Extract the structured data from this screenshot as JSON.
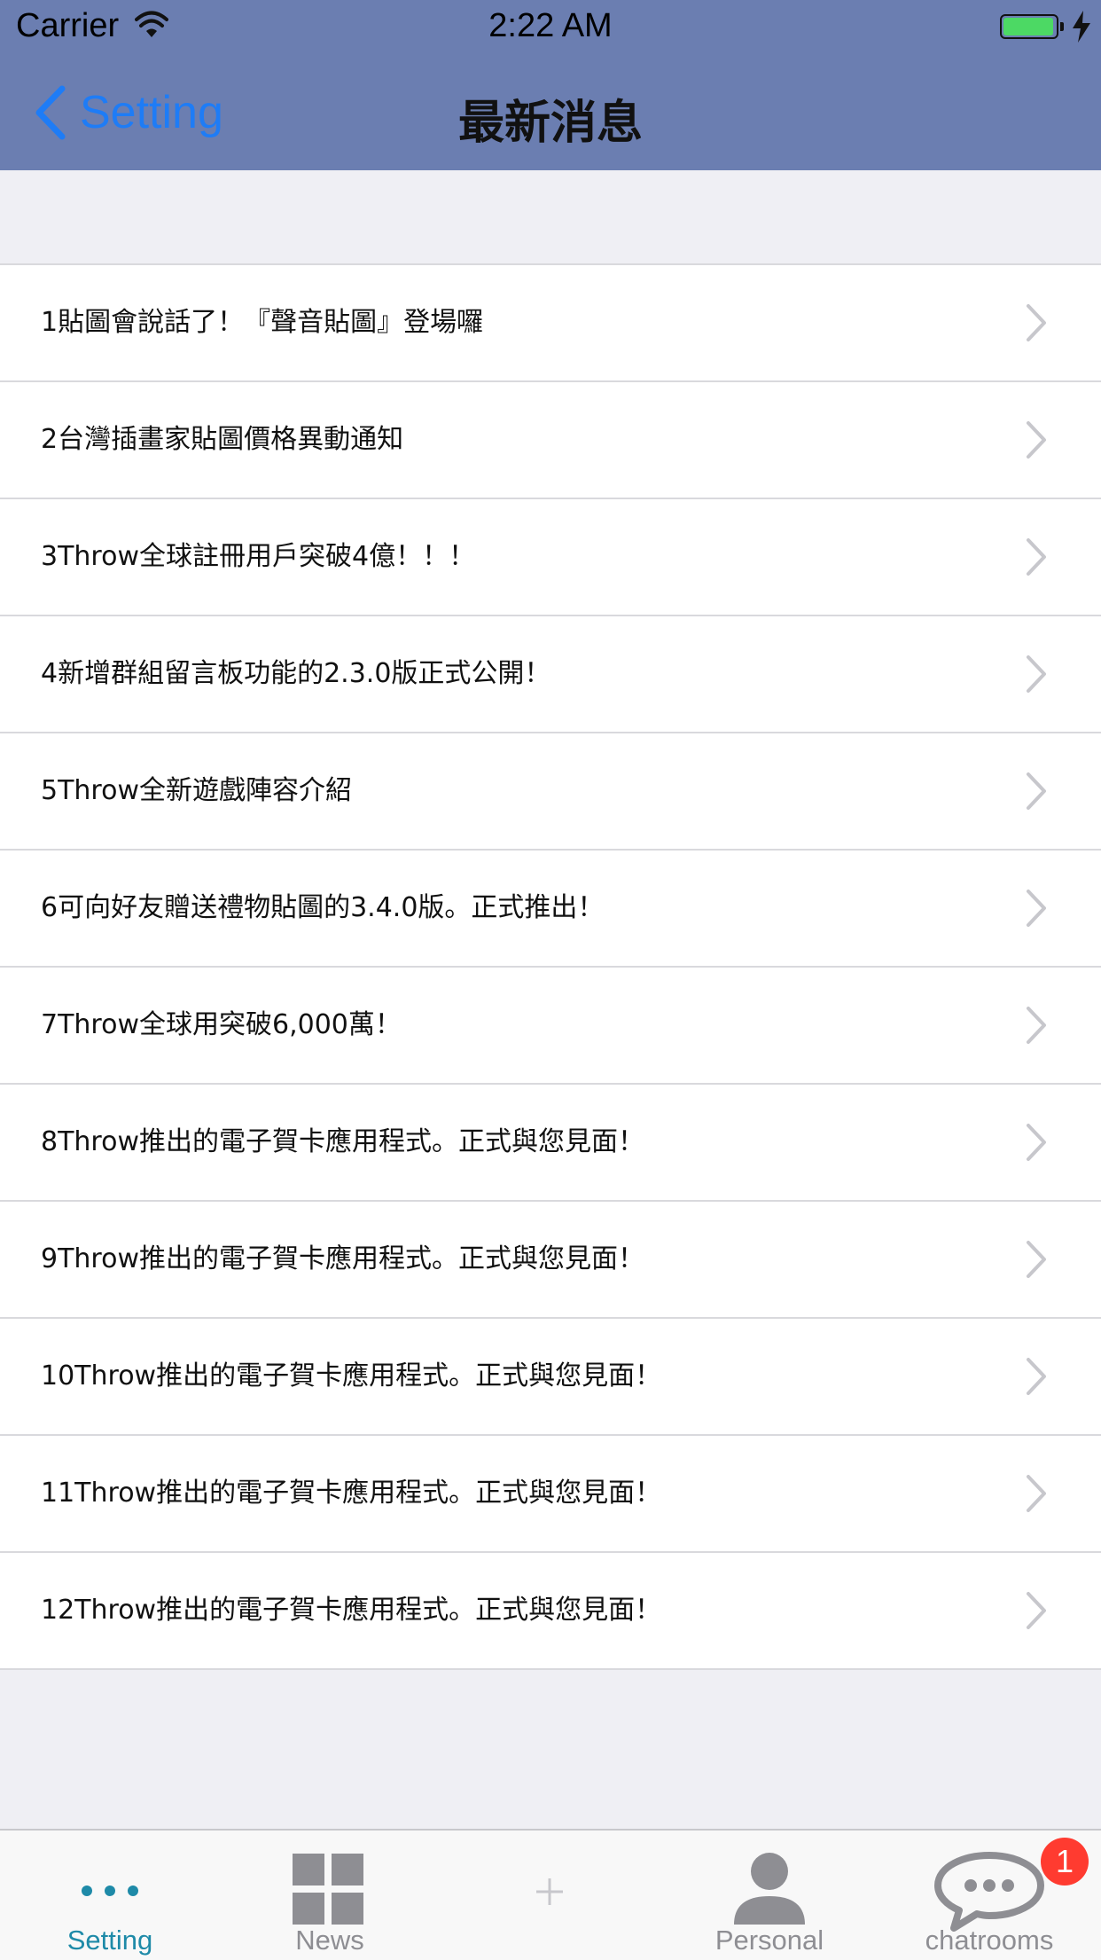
{
  "status_bar": {
    "carrier": "Carrier",
    "time": "2:22 AM"
  },
  "nav": {
    "back_label": "Setting",
    "title": "最新消息"
  },
  "news": [
    "1貼圖會說話了！『聲音貼圖』登場囉",
    "2台灣插畫家貼圖價格異動通知",
    "3Throw全球註冊用戶突破4億！！！",
    "4新增群組留言板功能的2.3.0版正式公開！",
    "5Throw全新遊戲陣容介紹",
    "6可向好友贈送禮物貼圖的3.4.0版。正式推出！",
    "7Throw全球用突破6,000萬！",
    "8Throw推出的電子賀卡應用程式。正式與您見面！",
    "9Throw推出的電子賀卡應用程式。正式與您見面！",
    "10Throw推出的電子賀卡應用程式。正式與您見面！",
    "11Throw推出的電子賀卡應用程式。正式與您見面！",
    "12Throw推出的電子賀卡應用程式。正式與您見面！"
  ],
  "tabs": {
    "setting": "Setting",
    "news": "News",
    "personal": "Personal",
    "chatrooms": "chatrooms",
    "chat_badge": "1"
  },
  "colors": {
    "nav_background": "#6b7eb1",
    "accent_blue": "#1e7cf6",
    "active_tab": "#1e8aa8",
    "badge": "#ff3b30"
  },
  "icons": {
    "back": "chevron-left-icon",
    "row": "chevron-right-icon",
    "setting_tab": "more-dots-icon",
    "news_tab": "grid-icon",
    "center_tab": "plus-icon",
    "personal_tab": "person-icon",
    "chatrooms_tab": "chat-bubble-icon"
  }
}
